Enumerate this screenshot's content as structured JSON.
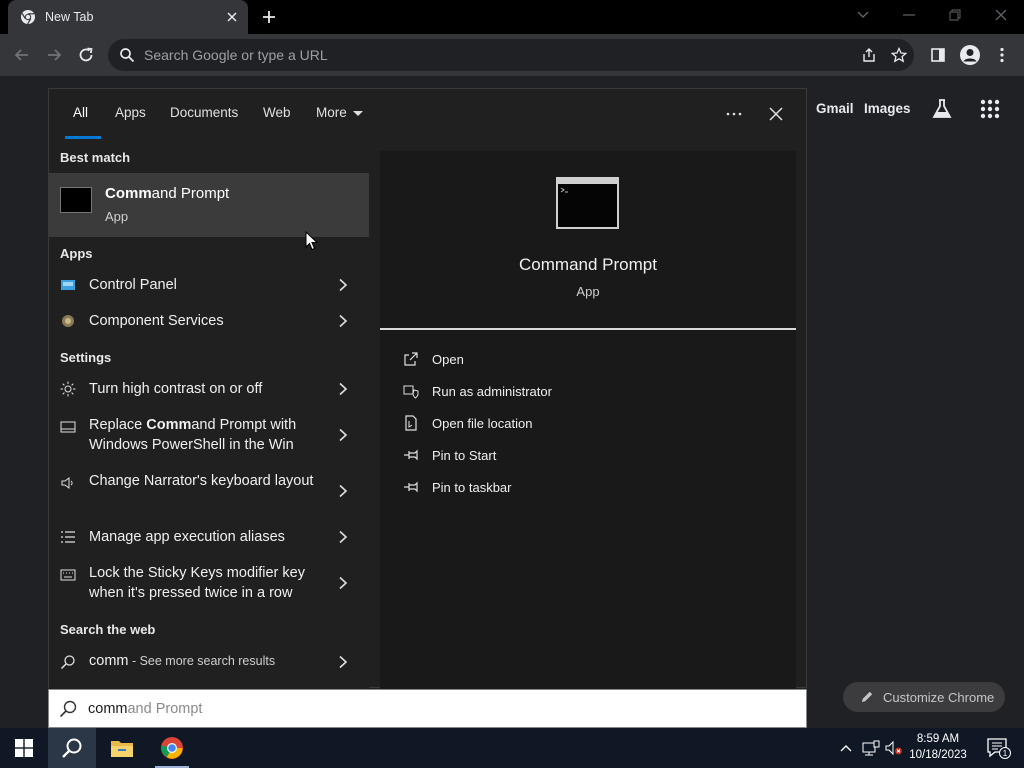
{
  "browser": {
    "tab_title": "New Tab",
    "omnibox_placeholder": "Search Google or type a URL",
    "links": {
      "gmail": "Gmail",
      "images": "Images"
    },
    "customize_label": "Customize Chrome"
  },
  "search_panel": {
    "filters": {
      "all": "All",
      "apps": "Apps",
      "documents": "Documents",
      "web": "Web",
      "more": "More"
    },
    "active_filter": "All",
    "best_match_heading": "Best match",
    "best_match": {
      "title_bold": "Comm",
      "title_rest": "and Prompt",
      "subtitle": "App"
    },
    "apps_heading": "Apps",
    "apps": [
      {
        "label": "Control Panel",
        "icon": "control-panel-icon"
      },
      {
        "label": "Component Services",
        "icon": "component-services-icon"
      }
    ],
    "settings_heading": "Settings",
    "settings": [
      {
        "pre": "",
        "bold": "",
        "rest": "Turn high contrast on or off",
        "icon": "brightness-icon"
      },
      {
        "pre": "Replace ",
        "bold": "Comm",
        "rest": "and Prompt with Windows PowerShell in the Win",
        "icon": "taskbar-settings-icon"
      },
      {
        "pre": "",
        "bold": "",
        "rest": "Change Narrator's keyboard layout",
        "icon": "narrator-icon"
      },
      {
        "pre": "",
        "bold": "",
        "rest": "Manage app execution aliases",
        "icon": "list-icon"
      },
      {
        "pre": "",
        "bold": "",
        "rest": "Lock the Sticky Keys modifier key when it's pressed twice in a row",
        "icon": "keyboard-icon"
      }
    ],
    "web_heading": "Search the web",
    "web_result": {
      "query": "comm",
      "suffix": " - See more search results"
    },
    "preview": {
      "title": "Command Prompt",
      "subtitle": "App",
      "actions": [
        {
          "label": "Open",
          "icon": "open-icon"
        },
        {
          "label": "Run as administrator",
          "icon": "shield-icon"
        },
        {
          "label": "Open file location",
          "icon": "file-location-icon"
        },
        {
          "label": "Pin to Start",
          "icon": "pin-icon"
        },
        {
          "label": "Pin to taskbar",
          "icon": "pin-icon"
        }
      ]
    },
    "search_box": {
      "typed": "comm",
      "autocomplete": "and Prompt"
    }
  },
  "taskbar": {
    "time": "8:59 AM",
    "date": "10/18/2023",
    "notification_count": "1"
  },
  "colors": {
    "accent": "#0078d4",
    "panel": "#202020",
    "preview": "#191919",
    "chrome_bg": "#202124",
    "taskbar": "#101826"
  }
}
